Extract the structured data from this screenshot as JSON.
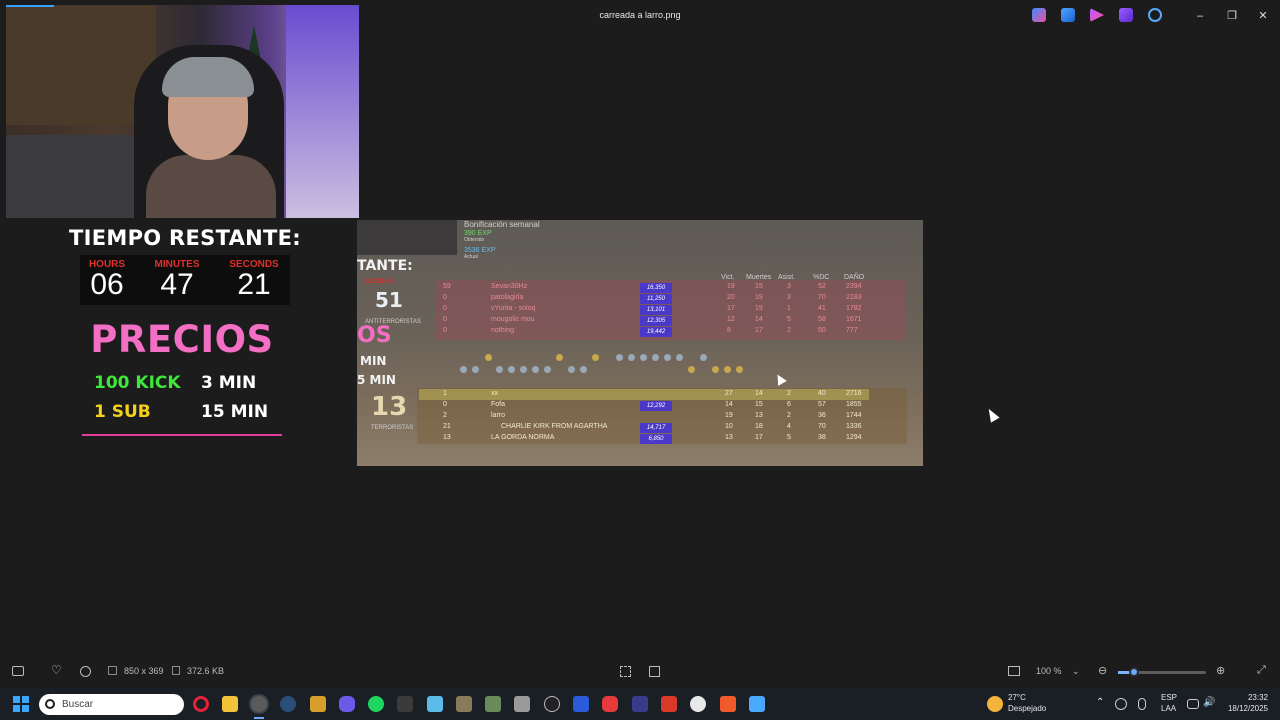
{
  "window": {
    "title": "carreada a larro.png",
    "minimize_label": "–",
    "maximize_label": "❐",
    "close_label": "✕",
    "title_icons": [
      "copilot-icon",
      "paint-icon",
      "clipchamp-icon",
      "video-editor-icon",
      "cloud-off-icon"
    ]
  },
  "overlay": {
    "timer": {
      "title": "TIEMPO RESTANTE:",
      "labels": [
        "HOURS",
        "MINUTES",
        "SECONDS"
      ],
      "values": [
        "06",
        "47",
        "21"
      ]
    },
    "prices": {
      "title": "PRECIOS",
      "rows": [
        {
          "item": "100 KICK",
          "time": "3 MIN",
          "item_color": "#3ee83a"
        },
        {
          "item": "1 SUB",
          "time": "15 MIN",
          "item_color": "#f4d21c"
        }
      ]
    }
  },
  "game": {
    "bonus": "Bonificación semanal",
    "exp_obtained": "390 EXP",
    "obtained_label": "Obtenido",
    "exp_current": "3536 EXP",
    "current_label": "Actual",
    "overlay_title_fragment": "TANTE:",
    "overlay_seconds_fragment": "SECONDS",
    "overlay_seconds_value": "51",
    "overlay_os": "OS",
    "overlay_min": "MIN",
    "overlay_5min": "5 MIN",
    "columns": [
      "Vict.",
      "Muertes",
      "Asist.",
      "%DC",
      "DAÑO"
    ],
    "ct_team_label": "ANTITERRORISTAS",
    "t_team_label": "TERRORISTAS",
    "t_score": "13",
    "ct_players": [
      {
        "rank": "59",
        "name": "Sevan30Hz",
        "money": "16,350",
        "k": "19",
        "d": "15",
        "a": "3",
        "hs": "52",
        "dmg": "2394"
      },
      {
        "rank": "0",
        "name": "patolagirla",
        "money": "11,250",
        "k": "20",
        "d": "19",
        "a": "3",
        "hs": "70",
        "dmg": "2183"
      },
      {
        "rank": "0",
        "name": "vYurita - soloq",
        "money": "13,101",
        "k": "17",
        "d": "19",
        "a": "1",
        "hs": "41",
        "dmg": "1782"
      },
      {
        "rank": "0",
        "name": "mougolic mou",
        "money": "12,305",
        "k": "12",
        "d": "14",
        "a": "5",
        "hs": "58",
        "dmg": "1671"
      },
      {
        "rank": "0",
        "name": "nothing",
        "money": "19,442",
        "k": "8",
        "d": "17",
        "a": "2",
        "hs": "50",
        "dmg": "777"
      }
    ],
    "t_players": [
      {
        "rank": "1",
        "name": "xx",
        "money": "",
        "k": "27",
        "d": "14",
        "a": "2",
        "hs": "40",
        "dmg": "2716"
      },
      {
        "rank": "0",
        "name": "Fofa",
        "money": "12,292",
        "k": "14",
        "d": "15",
        "a": "6",
        "hs": "57",
        "dmg": "1855"
      },
      {
        "rank": "2",
        "name": "larro",
        "money": "",
        "k": "19",
        "d": "13",
        "a": "2",
        "hs": "36",
        "dmg": "1744"
      },
      {
        "rank": "21",
        "name": "CHARLIE KIRK FROM AGARTHA",
        "money": "14,717",
        "k": "10",
        "d": "18",
        "a": "4",
        "hs": "70",
        "dmg": "1336"
      },
      {
        "rank": "13",
        "name": "LA GORDA NORMA",
        "money": "6,850",
        "k": "13",
        "d": "17",
        "a": "5",
        "hs": "38",
        "dmg": "1294"
      }
    ]
  },
  "viewer": {
    "dimensions": "850 x 369",
    "file_size": "372.6 KB",
    "zoom": "100 %"
  },
  "taskbar": {
    "search_placeholder": "Buscar",
    "weather_temp": "27°C",
    "weather_desc": "Despejado",
    "lang": "ESP",
    "lang_sub": "LAA",
    "time": "23:32",
    "date": "18/12/2025",
    "apps": [
      "opera-icon",
      "file-explorer-icon",
      "chrome-icon",
      "steam-icon",
      "faceit-icon",
      "discord-icon",
      "spotify-icon",
      "medal-icon",
      "notepad-icon",
      "game-icon",
      "game2-icon",
      "car-game-icon",
      "obs-icon",
      "vanguard-icon",
      "remote-icon",
      "streamer-icon",
      "youtube-streamer-icon",
      "app-icon",
      "brave-icon",
      "paint-icon"
    ]
  }
}
